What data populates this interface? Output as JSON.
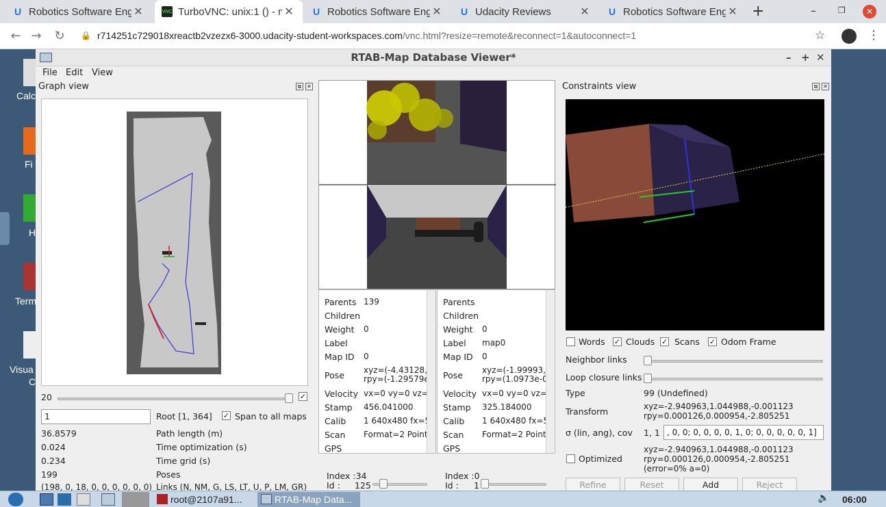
{
  "browser": {
    "tabs": [
      {
        "label": "Robotics Software Eng",
        "icon": "udacity-icon"
      },
      {
        "label": "TurboVNC: unix:1 () - n",
        "icon": "vnc-icon"
      },
      {
        "label": "Robotics Software Eng",
        "icon": "udacity-icon"
      },
      {
        "label": "Udacity Reviews",
        "icon": "udacity-icon"
      },
      {
        "label": "Robotics Software Eng",
        "icon": "udacity-icon"
      }
    ],
    "new_tab": "+",
    "url_main": "r714251c729018xreactb2vzezx6-3000.udacity-student-workspaces.com",
    "url_rest": "/vnc.html?resize=remote&reconnect=1&autoconnect=1"
  },
  "desktop": {
    "labels": [
      "Calc",
      "Fi",
      "H",
      "Term",
      "Visua",
      "C"
    ]
  },
  "app": {
    "title": "RTAB-Map Database Viewer*",
    "menu": [
      "File",
      "Edit",
      "View"
    ],
    "graph_view": {
      "title": "Graph view",
      "slider_value": "20",
      "spin_value": "1",
      "root": "Root [1, 364]",
      "span_label": "Span to all maps",
      "stats": [
        {
          "value": "36.8579",
          "label": "Path length (m)"
        },
        {
          "value": "0.024",
          "label": "Time optimization (s)"
        },
        {
          "value": "0.234",
          "label": "Time grid (s)"
        },
        {
          "value": "199",
          "label": "Poses"
        },
        {
          "value": "(198, 0, 18, 0, 0, 0, 0, 0, 0)",
          "label": "Links (N, NM, G, LS, LT, U, P, LM, GR)"
        }
      ]
    },
    "node_left": {
      "rows": [
        {
          "k": "Parents",
          "v": "139"
        },
        {
          "k": "Children",
          "v": ""
        },
        {
          "k": "Weight",
          "v": "0"
        },
        {
          "k": "Label",
          "v": ""
        },
        {
          "k": "Map ID",
          "v": "0"
        },
        {
          "k": "Pose",
          "v": "xyz=(-4.43128,",
          "v2": "rpy=(-1.29579e"
        },
        {
          "k": "Velocity",
          "v": "vx=0 vy=0 vz="
        },
        {
          "k": "Stamp",
          "v": "456.041000"
        },
        {
          "k": "Calib",
          "v": "1 640x480 fx=5"
        },
        {
          "k": "Scan",
          "v": "Format=2 Point"
        },
        {
          "k": "GPS",
          "v": ""
        }
      ],
      "index_label": "Index :34",
      "id_label": "Id :",
      "id_value": "125"
    },
    "node_right": {
      "rows": [
        {
          "k": "Parents",
          "v": ""
        },
        {
          "k": "Children",
          "v": ""
        },
        {
          "k": "Weight",
          "v": "0"
        },
        {
          "k": "Label",
          "v": "map0"
        },
        {
          "k": "Map ID",
          "v": "0"
        },
        {
          "k": "Pose",
          "v": "xyz=(-1.99993,",
          "v2": "rpy=(1.0973e-0"
        },
        {
          "k": "Velocity",
          "v": "vx=0 vy=0 vz="
        },
        {
          "k": "Stamp",
          "v": "325.184000"
        },
        {
          "k": "Calib",
          "v": "1 640x480 fx=5"
        },
        {
          "k": "Scan",
          "v": "Format=2 Point"
        },
        {
          "k": "GPS",
          "v": ""
        }
      ],
      "index_label": "Index :0",
      "id_label": "Id :",
      "id_value": "1"
    },
    "constraints": {
      "title": "Constraints view",
      "checks": [
        {
          "label": "Words",
          "checked": false
        },
        {
          "label": "Clouds",
          "checked": true
        },
        {
          "label": "Scans",
          "checked": true
        },
        {
          "label": "Odom Frame",
          "checked": true
        }
      ],
      "neighbor_links": "Neighbor links",
      "loop_links": "Loop closure links",
      "type_label": "Type",
      "type_value": "99  (Undefined)",
      "transform_label": "Transform",
      "transform_xyz": "xyz=-2.940963,1.044988,-0.001123",
      "transform_rpy": "rpy=0.000126,0.000954,-2.805251",
      "sigma_label": "σ (lin, ang), cov",
      "sigma_value": "1, 1",
      "cov_value": ", 0, 0;  0, 0, 0, 0, 1, 0;  0, 0, 0, 0, 0, 1]",
      "optimized_label": "Optimized",
      "opt_xyz": "xyz=-2.940963,1.044988,-0.001123",
      "opt_rpy": "rpy=0.000126,0.000954,-2.805251",
      "opt_err": "(error=0% a=0)",
      "buttons": [
        "Refine",
        "Reset",
        "Add",
        "Reject"
      ]
    }
  },
  "taskbar": {
    "items": [
      "root@2107a91...",
      "RTAB-Map Data..."
    ],
    "clock": "06:00"
  }
}
